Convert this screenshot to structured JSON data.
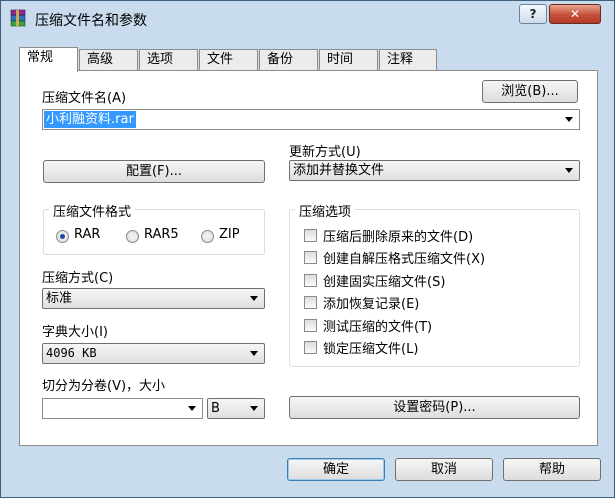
{
  "window": {
    "title": "压缩文件名和参数",
    "help_glyph": "?",
    "close_glyph": "✕"
  },
  "tabs": [
    "常规",
    "高级",
    "选项",
    "文件",
    "备份",
    "时间",
    "注释"
  ],
  "archive_name": {
    "label": "压缩文件名(A)",
    "value": "小利融资料.rar",
    "browse_label": "浏览(B)..."
  },
  "update_mode": {
    "label": "更新方式(U)",
    "value": "添加并替换文件"
  },
  "profiles_button": "配置(F)...",
  "archive_format": {
    "title": "压缩文件格式",
    "options": [
      "RAR",
      "RAR5",
      "ZIP"
    ],
    "selected": "RAR"
  },
  "compression_method": {
    "label": "压缩方式(C)",
    "value": "标准"
  },
  "dictionary_size": {
    "label": "字典大小(I)",
    "value": "4096 KB"
  },
  "split_volumes": {
    "label": "切分为分卷(V)，大小",
    "value": "",
    "unit": "B"
  },
  "archiving_options": {
    "title": "压缩选项",
    "items": [
      {
        "label": "压缩后删除原来的文件(D)",
        "checked": false
      },
      {
        "label": "创建自解压格式压缩文件(X)",
        "checked": false
      },
      {
        "label": "创建固实压缩文件(S)",
        "checked": false
      },
      {
        "label": "添加恢复记录(E)",
        "checked": false
      },
      {
        "label": "测试压缩的文件(T)",
        "checked": false
      },
      {
        "label": "锁定压缩文件(L)",
        "checked": false
      }
    ]
  },
  "password_button": "设置密码(P)...",
  "footer": {
    "ok": "确定",
    "cancel": "取消",
    "help": "帮助"
  }
}
